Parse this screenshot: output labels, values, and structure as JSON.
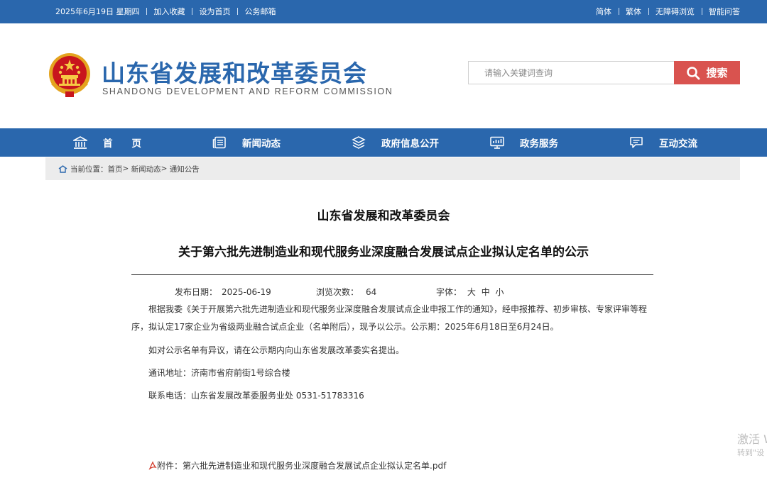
{
  "topbar": {
    "date": "2025年6月19日 星期四",
    "links_left": [
      "加入收藏",
      "设为首页",
      "公务邮箱"
    ],
    "links_right": [
      "简体",
      "繁体",
      "无障碍浏览",
      "智能问答"
    ]
  },
  "header": {
    "title": "山东省发展和改革委员会",
    "subtitle": "SHANDONG DEVELOPMENT AND REFORM COMMISSION",
    "search_placeholder": "请输入关键词查询",
    "search_label": "搜索"
  },
  "nav": {
    "items": [
      {
        "label": "首　　页",
        "icon": "home-icon"
      },
      {
        "label": "新闻动态",
        "icon": "news-icon"
      },
      {
        "label": "政府信息公开",
        "icon": "layers-icon"
      },
      {
        "label": "政务服务",
        "icon": "monitor-icon"
      },
      {
        "label": "互动交流",
        "icon": "chat-icon"
      }
    ]
  },
  "breadcrumb": {
    "prefix": "当前位置：",
    "items": [
      "首页",
      "新闻动态",
      "通知公告"
    ]
  },
  "article": {
    "org": "山东省发展和改革委员会",
    "title": "关于第六批先进制造业和现代服务业深度融合发展试点企业拟认定名单的公示",
    "publish_label": "发布日期：",
    "publish_date": "2025-06-19",
    "views_label": "浏览次数：",
    "views": "64",
    "font_label": "字体：",
    "font_sizes": [
      "大",
      "中",
      "小"
    ],
    "paragraphs": [
      "根据我委《关于开展第六批先进制造业和现代服务业深度融合发展试点企业申报工作的通知》，经申报推荐、初步审核、专家评审等程序，拟认定17家企业为省级两业融合试点企业（名单附后），现予以公示。公示期：2025年6月18日至6月24日。",
      "如对公示名单有异议，请在公示期内向山东省发展改革委实名提出。",
      "通讯地址：济南市省府前街1号综合楼",
      "联系电话：山东省发展改革委服务业处 0531-51783316"
    ],
    "attachment_label": "附件：",
    "attachment_name": "第六批先进制造业和现代服务业深度融合发展试点企业拟认定名单.pdf"
  },
  "watermark": {
    "line1": "激活 W",
    "line2": "转到\"设"
  },
  "colors": {
    "primary_blue": "#2a67ad",
    "search_red": "#d9534f",
    "breadcrumb_bg": "#ececec"
  }
}
